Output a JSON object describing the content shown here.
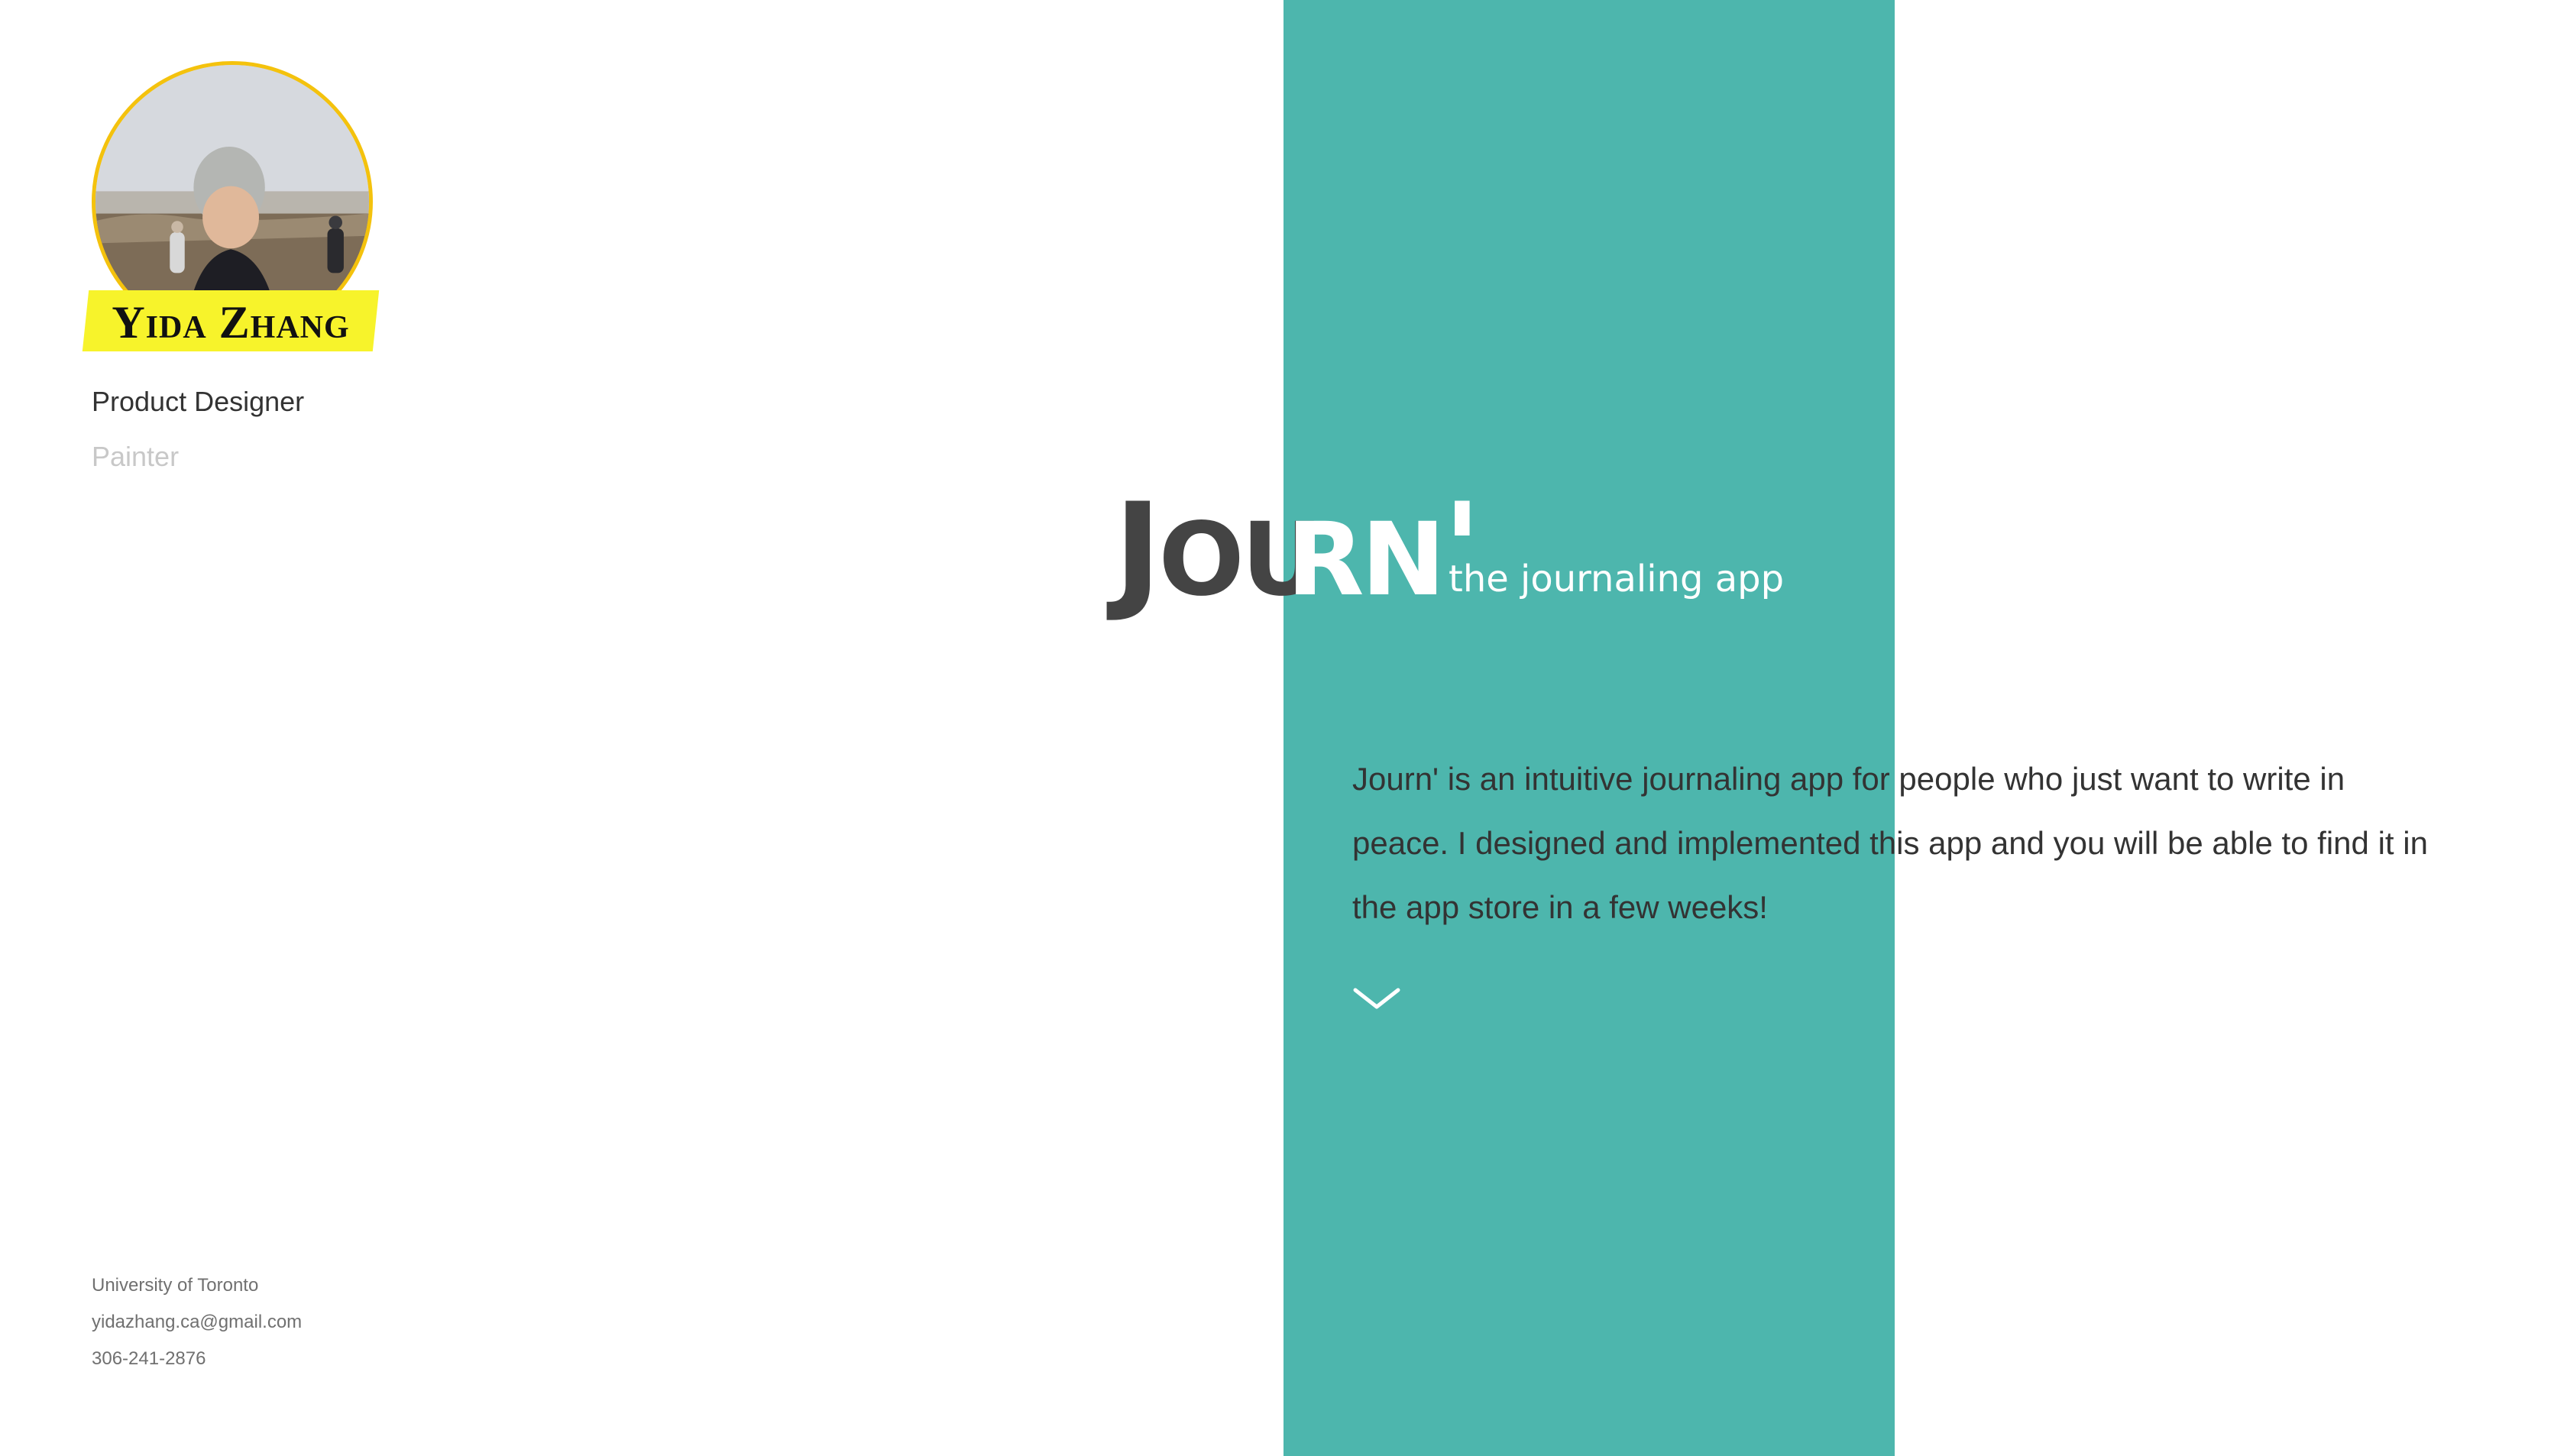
{
  "profile": {
    "name": "Yida Zhang",
    "roles": [
      "Product Designer",
      "Painter"
    ],
    "contact": {
      "school": "University of Toronto",
      "email": "yidazhang.ca@gmail.com",
      "phone": "306-241-2876"
    }
  },
  "hero": {
    "title_dark_first": "J",
    "title_dark_rest": "OU",
    "title_light_rest": "RN",
    "title_apostrophe": "'",
    "tagline": "the journaling app",
    "description": "Journ' is an intuitive journaling app for people who just want to write in peace. I designed and implemented this app and you will be able to find it in the app store in a few weeks!"
  },
  "icons": {
    "scroll": "chevron-down-icon"
  },
  "colors": {
    "teal": "#4db6ad",
    "highlight": "#f7f32b",
    "avatar_border": "#f4c20d",
    "dark_text": "#444444"
  }
}
